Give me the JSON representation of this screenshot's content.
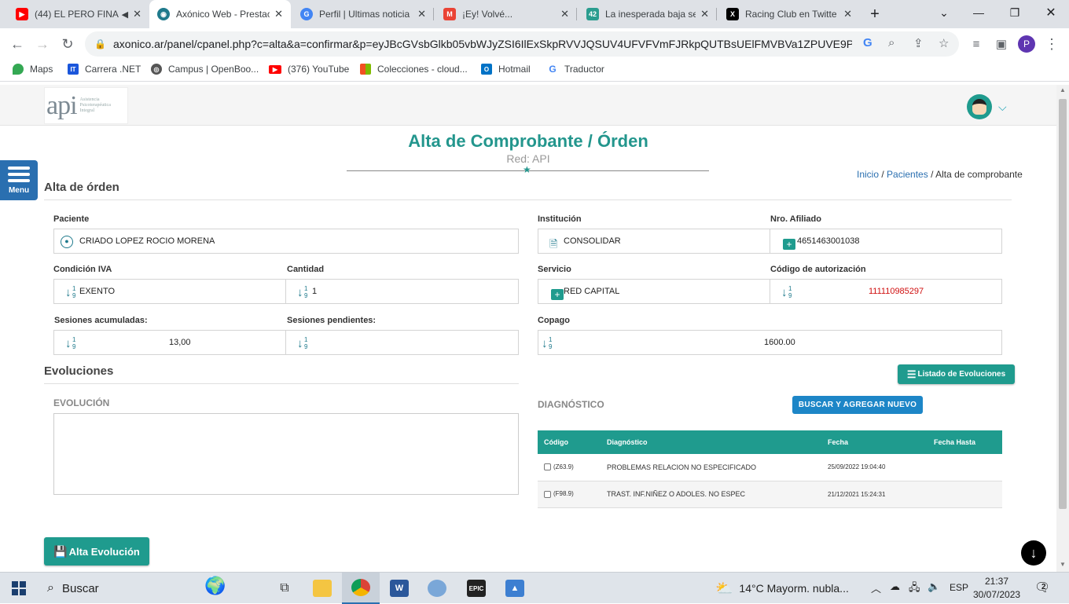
{
  "browser": {
    "tabs": [
      {
        "title": "(44) EL PERO FINA",
        "icon": "youtube-icon",
        "color": "#ff0000"
      },
      {
        "title": "Axónico Web - Prestac",
        "icon": "axonico-icon",
        "color": "#1f7a8c"
      },
      {
        "title": "Perfil | Ultimas noticia",
        "icon": "google-icon",
        "color": "#4285f4"
      },
      {
        "title": "¡Ey! Volvé...",
        "icon": "gmail-icon",
        "color": "#ea4335"
      },
      {
        "title": "La inesperada baja se",
        "icon": "site-42-icon",
        "color": "#2a9d8f"
      },
      {
        "title": "Racing Club en Twitte",
        "icon": "x-icon",
        "color": "#000000"
      }
    ],
    "url": "axonico.ar/panel/cpanel.php?c=alta&a=confirmar&p=eyJBcGVsbGlkb05vbWJyZSI6IlExSkpRVVJQSUV4UFVFVmFJRkpQUTBsUElFMVBVa1ZPUVE9PSIsImI...",
    "profile_initial": "P",
    "bookmarks": [
      {
        "label": "Maps",
        "icon": "maps-icon",
        "color": "#34a853"
      },
      {
        "label": "Carrera .NET",
        "icon": "bookmark-it-icon",
        "color": "#1a56db"
      },
      {
        "label": "Campus | OpenBoo...",
        "icon": "globe-icon",
        "color": "#555555"
      },
      {
        "label": "(376) YouTube",
        "icon": "youtube-icon",
        "color": "#ff0000"
      },
      {
        "label": "Colecciones - cloud...",
        "icon": "microsoft-icon",
        "color": "#f25022"
      },
      {
        "label": "Hotmail",
        "icon": "outlook-icon",
        "color": "#0072c6"
      },
      {
        "label": "Traductor",
        "icon": "google-translate-icon",
        "color": "#4285f4"
      }
    ]
  },
  "page": {
    "logo_text": "api",
    "logo_sub": [
      "Asistencia",
      "Psicoterapéutica",
      "Integral"
    ],
    "menu_label": "Menu",
    "title": "Alta de Comprobante / Órden",
    "subtitle": "Red: API",
    "breadcrumb": {
      "inicio": "Inicio",
      "sep1": " / ",
      "pacientes": "Pacientes",
      "sep2": " / ",
      "current": "Alta de comprobante"
    },
    "section_orden": "Alta de órden",
    "fields": {
      "paciente": {
        "label": "Paciente",
        "value": "CRIADO LOPEZ ROCIO MORENA"
      },
      "institucion": {
        "label": "Institución",
        "value": "CONSOLIDAR"
      },
      "afiliado": {
        "label": "Nro. Afiliado",
        "value": "4651463001038"
      },
      "iva": {
        "label": "Condición IVA",
        "value": "EXENTO"
      },
      "cantidad": {
        "label": "Cantidad",
        "value": "1"
      },
      "servicio": {
        "label": "Servicio",
        "value": "RED CAPITAL"
      },
      "autorizacion": {
        "label": "Código de autorización",
        "value": "111110985297"
      },
      "sesiones_acum": {
        "label": "Sesiones acumuladas:",
        "value": "13,00"
      },
      "sesiones_pend": {
        "label": "Sesiones pendientes:",
        "value": ""
      },
      "copago": {
        "label": "Copago",
        "value": "1600.00"
      }
    },
    "sort_icon": {
      "one": "1",
      "nine": "9"
    },
    "section_evoluciones": "Evoluciones",
    "listado_btn": "Listado de Evoluciones",
    "evolucion_label": "EVOLUCIÓN",
    "diagnostico_label": "DIAGNÓSTICO",
    "buscar_btn": "BUSCAR Y AGREGAR NUEVO",
    "dx_table": {
      "headers": [
        "Código",
        "Diagnóstico",
        "Fecha",
        "Fecha Hasta"
      ],
      "rows": [
        {
          "code": "(Z63.9)",
          "desc": "PROBLEMAS RELACION NO ESPECIFICADO",
          "fecha": "25/09/2022 19:04:40",
          "hasta": ""
        },
        {
          "code": "(F98.9)",
          "desc": "TRAST. INF.NIÑEZ O ADOLES. NO ESPEC",
          "fecha": "21/12/2021 15:24:31",
          "hasta": ""
        }
      ]
    },
    "alta_btn": "Alta Evolución"
  },
  "taskbar": {
    "search": "Buscar",
    "weather": "14°C  Mayorm. nubla...",
    "lang": "ESP",
    "time": "21:37",
    "date": "30/07/2023",
    "notif_count": "2"
  }
}
